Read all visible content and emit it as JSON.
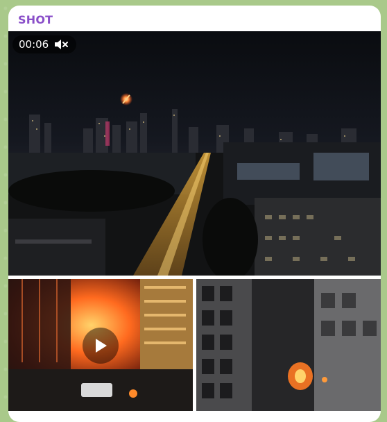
{
  "message": {
    "sender": "SHOT",
    "video": {
      "duration": "00:06",
      "muted": true
    }
  },
  "icons": {
    "mute": "speaker-muted-icon",
    "play": "play-icon"
  },
  "colors": {
    "sender": "#8a4fc9",
    "chat_background": "#a9c98a"
  }
}
